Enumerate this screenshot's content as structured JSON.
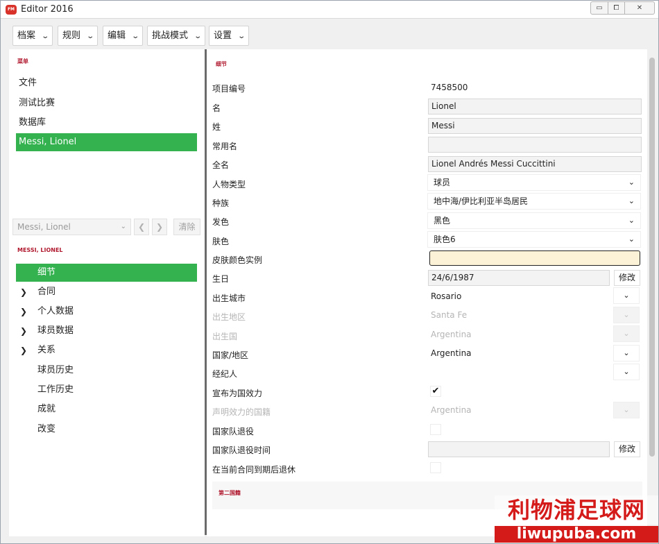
{
  "window": {
    "title": "Editor 2016",
    "app_icon_text": "FM"
  },
  "window_controls": {
    "minimize": "▭",
    "maximize": "⧠",
    "close": "✕"
  },
  "menu": [
    {
      "label": "档案"
    },
    {
      "label": "规则"
    },
    {
      "label": "编辑"
    },
    {
      "label": "挑战模式"
    },
    {
      "label": "设置"
    }
  ],
  "sidebar": {
    "menu_title": "菜单",
    "menu_items": [
      "文件",
      "测试比赛",
      "数据库",
      "Messi, Lionel"
    ],
    "active_menu_item": "Messi, Lionel",
    "record_select": "Messi, Lionel",
    "prev_symbol": "❮",
    "next_symbol": "❯",
    "clear_label": "清除",
    "person_title": "MESSI, LIONEL",
    "tree": [
      {
        "label": "细节",
        "expandable": false,
        "active": true
      },
      {
        "label": "合同",
        "expandable": true
      },
      {
        "label": "个人数据",
        "expandable": true
      },
      {
        "label": "球员数据",
        "expandable": true
      },
      {
        "label": "关系",
        "expandable": true
      },
      {
        "label": "球员历史",
        "expandable": false
      },
      {
        "label": "工作历史",
        "expandable": false
      },
      {
        "label": "成就",
        "expandable": false
      },
      {
        "label": "改变",
        "expandable": false
      }
    ],
    "expand_symbol": "❯"
  },
  "details": {
    "section_title": "细节",
    "id_label": "项目编号",
    "id_value": "7458500",
    "first_name_label": "名",
    "first_name": "Lionel",
    "last_name_label": "姓",
    "last_name": "Messi",
    "common_name_label": "常用名",
    "common_name": "",
    "full_name_label": "全名",
    "full_name": "Lionel Andrés Messi Cuccittini",
    "person_type_label": "人物类型",
    "person_type": "球员",
    "ethnicity_label": "种族",
    "ethnicity": "地中海/伊比利亚半岛居民",
    "hair_label": "发色",
    "hair": "黑色",
    "skin_label": "肤色",
    "skin": "肤色6",
    "skin_sample_label": "皮肤颜色实例",
    "skin_sample_color": "#fbf2d8",
    "dob_label": "生日",
    "dob": "24/6/1987",
    "dob_edit": "修改",
    "birth_city_label": "出生城市",
    "birth_city": "Rosario",
    "birth_region_label": "出生地区",
    "birth_region": "Santa Fe",
    "birth_country_label": "出生国",
    "birth_country": "Argentina",
    "nation_label": "国家/地区",
    "nation": "Argentina",
    "agent_label": "经纪人",
    "agent": "",
    "declared_label": "宣布为国效力",
    "declared": true,
    "declared_nation_label": "声明效力的国籍",
    "declared_nation": "Argentina",
    "intl_retired_label": "国家队退役",
    "intl_retired": false,
    "intl_retire_date_label": "国家队退役时间",
    "intl_retire_date": "",
    "intl_retire_edit": "修改",
    "retire_after_contract_label": "在当前合同到期后退休",
    "retire_after_contract": false,
    "check_symbol": "✔",
    "dropdown_symbol": "⌄"
  },
  "second_nationality": {
    "title": "第二国籍"
  },
  "watermark": {
    "text": "利物浦足球网",
    "url": "liwupuba.com"
  },
  "colors": {
    "accent_green": "#33b24f",
    "section_red": "#b0182e",
    "splitter": "#6b6b6b"
  }
}
